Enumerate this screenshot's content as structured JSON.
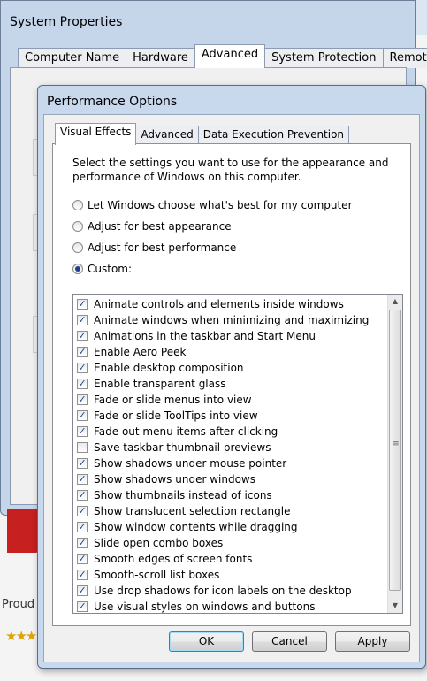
{
  "system_properties": {
    "title": "System Properties",
    "tabs": [
      "Computer Name",
      "Hardware",
      "Advanced",
      "System Protection",
      "Remote"
    ],
    "active_tab": "Advanced"
  },
  "background": {
    "proud_text": "Proud",
    "stars": "★★★"
  },
  "performance_options": {
    "title": "Performance Options",
    "tabs": [
      "Visual Effects",
      "Advanced",
      "Data Execution Prevention"
    ],
    "active_tab": "Visual Effects",
    "description": "Select the settings you want to use for the appearance and performance of Windows on this computer.",
    "radios": [
      {
        "label": "Let Windows choose what's best for my computer",
        "selected": false
      },
      {
        "label": "Adjust for best appearance",
        "selected": false
      },
      {
        "label": "Adjust for best performance",
        "selected": false
      },
      {
        "label": "Custom:",
        "selected": true
      }
    ],
    "effects": [
      {
        "label": "Animate controls and elements inside windows",
        "checked": true
      },
      {
        "label": "Animate windows when minimizing and maximizing",
        "checked": true
      },
      {
        "label": "Animations in the taskbar and Start Menu",
        "checked": true
      },
      {
        "label": "Enable Aero Peek",
        "checked": true
      },
      {
        "label": "Enable desktop composition",
        "checked": true
      },
      {
        "label": "Enable transparent glass",
        "checked": true
      },
      {
        "label": "Fade or slide menus into view",
        "checked": true
      },
      {
        "label": "Fade or slide ToolTips into view",
        "checked": true
      },
      {
        "label": "Fade out menu items after clicking",
        "checked": true
      },
      {
        "label": "Save taskbar thumbnail previews",
        "checked": false
      },
      {
        "label": "Show shadows under mouse pointer",
        "checked": true
      },
      {
        "label": "Show shadows under windows",
        "checked": true
      },
      {
        "label": "Show thumbnails instead of icons",
        "checked": true
      },
      {
        "label": "Show translucent selection rectangle",
        "checked": true
      },
      {
        "label": "Show window contents while dragging",
        "checked": true
      },
      {
        "label": "Slide open combo boxes",
        "checked": true
      },
      {
        "label": "Smooth edges of screen fonts",
        "checked": true
      },
      {
        "label": "Smooth-scroll list boxes",
        "checked": true
      },
      {
        "label": "Use drop shadows for icon labels on the desktop",
        "checked": true
      },
      {
        "label": "Use visual styles on windows and buttons",
        "checked": true
      }
    ],
    "buttons": {
      "ok": "OK",
      "cancel": "Cancel",
      "apply": "Apply"
    }
  }
}
